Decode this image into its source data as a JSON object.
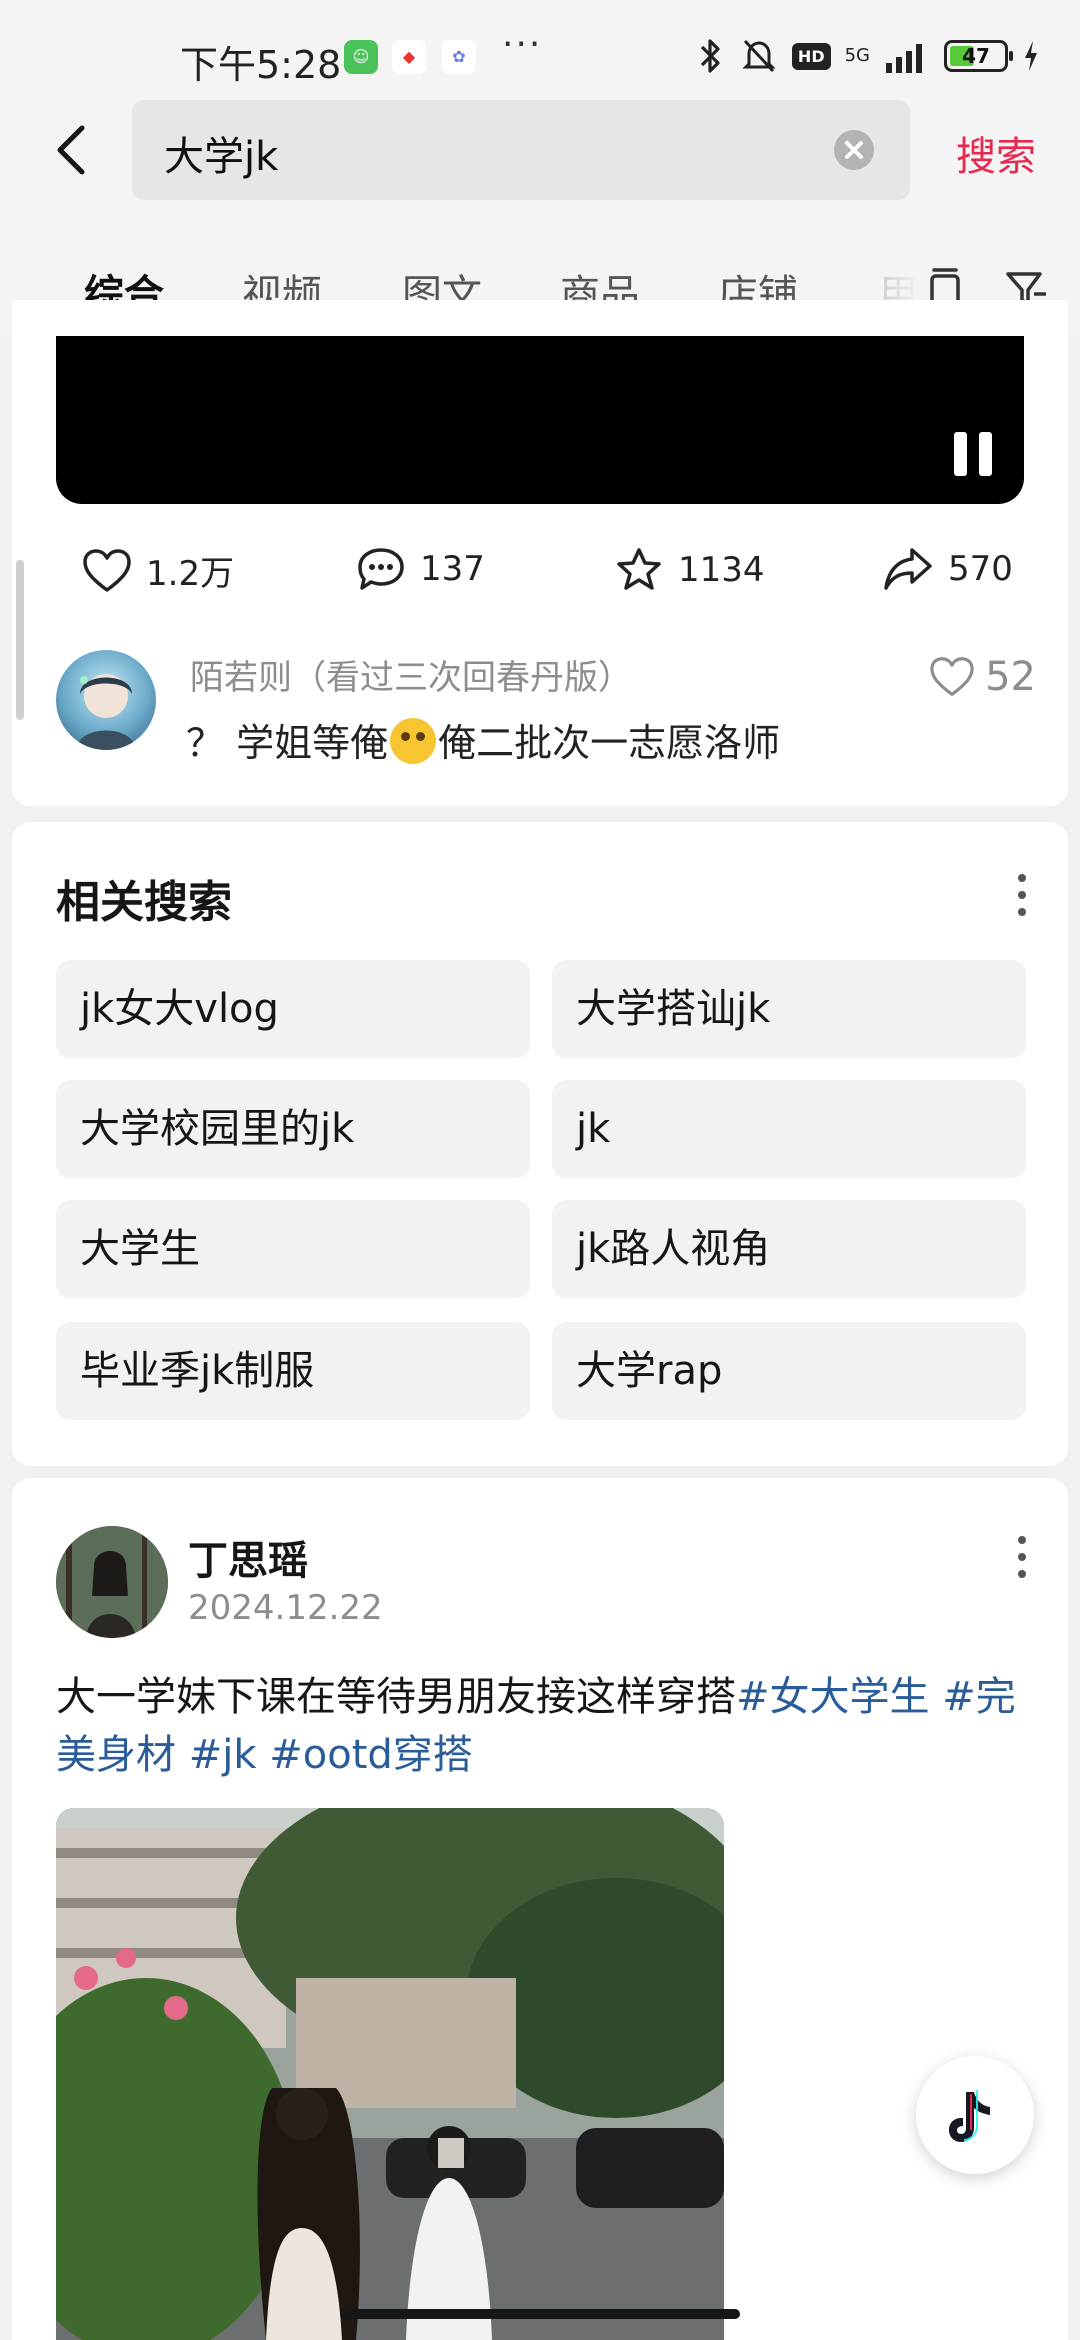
{
  "status_bar": {
    "time": "下午5:28",
    "network": "5G",
    "hd_label": "HD",
    "battery": "47",
    "battery_level": 0.47
  },
  "search": {
    "query": "大学jk",
    "submit_label": "搜索"
  },
  "tabs": [
    {
      "label": "综合",
      "active": true
    },
    {
      "label": "视频"
    },
    {
      "label": "图文"
    },
    {
      "label": "商品"
    },
    {
      "label": "店铺"
    },
    {
      "label": "用"
    }
  ],
  "video_card": {
    "stats": {
      "likes": "1.2万",
      "comments": "137",
      "favorites": "1134",
      "shares": "570"
    },
    "top_comment": {
      "author": "陌若则（看过三次回春丹版）",
      "text_before": "？ 学姐等俺",
      "text_after": "俺二批次一志愿洛师",
      "likes": "52"
    }
  },
  "related": {
    "title": "相关搜索",
    "items": [
      "jk女大vlog",
      "大学搭讪jk",
      "大学校园里的jk",
      "jk",
      "大学生",
      "jk路人视角",
      "毕业季jk制服",
      "大学rap"
    ]
  },
  "post": {
    "author": "丁思瑶",
    "date": "2024.12.22",
    "text": "大一学妹下课在等待男朋友接这样穿搭",
    "tags": [
      "#女大学生",
      "#完美身材",
      "#jk",
      "#ootd穿搭"
    ]
  },
  "colors": {
    "accent": "#e8284f",
    "tag": "#2a5c9a",
    "battery": "#54c93a"
  }
}
